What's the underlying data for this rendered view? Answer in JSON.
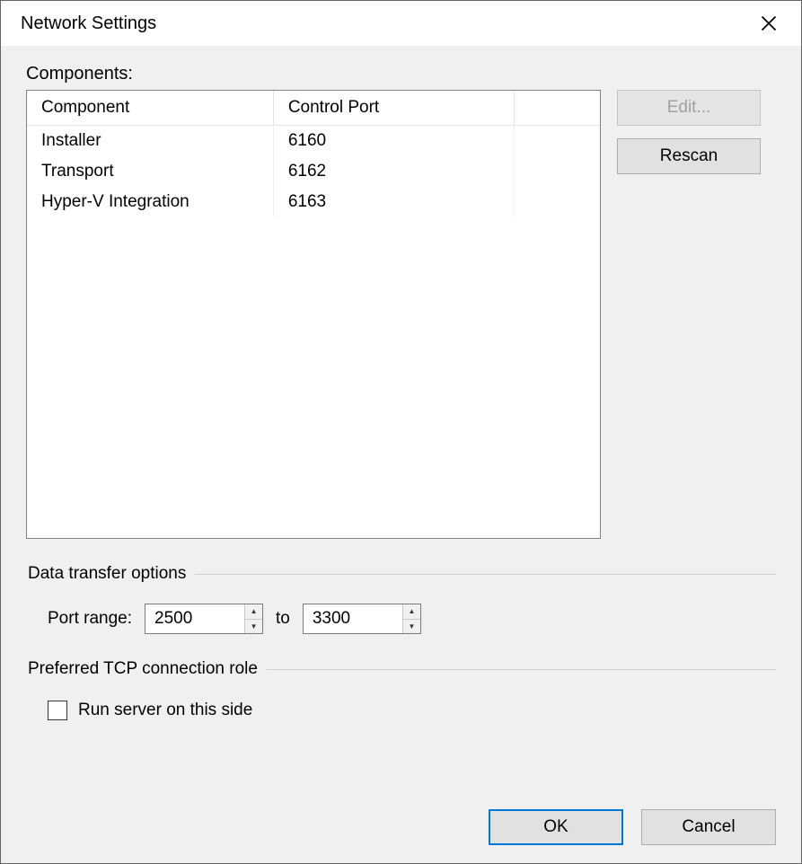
{
  "title": "Network Settings",
  "componentsLabel": "Components:",
  "table": {
    "headers": {
      "component": "Component",
      "port": "Control Port"
    },
    "rows": [
      {
        "component": "Installer",
        "port": "6160"
      },
      {
        "component": "Transport",
        "port": "6162"
      },
      {
        "component": "Hyper-V Integration",
        "port": "6163"
      }
    ]
  },
  "buttons": {
    "edit": "Edit...",
    "rescan": "Rescan",
    "ok": "OK",
    "cancel": "Cancel"
  },
  "dataTransfer": {
    "legend": "Data transfer options",
    "portRangeLabel": "Port range:",
    "toLabel": "to",
    "from": "2500",
    "to": "3300"
  },
  "tcpRole": {
    "legend": "Preferred TCP connection role",
    "runServerLabel": "Run server on this side",
    "checked": false
  }
}
